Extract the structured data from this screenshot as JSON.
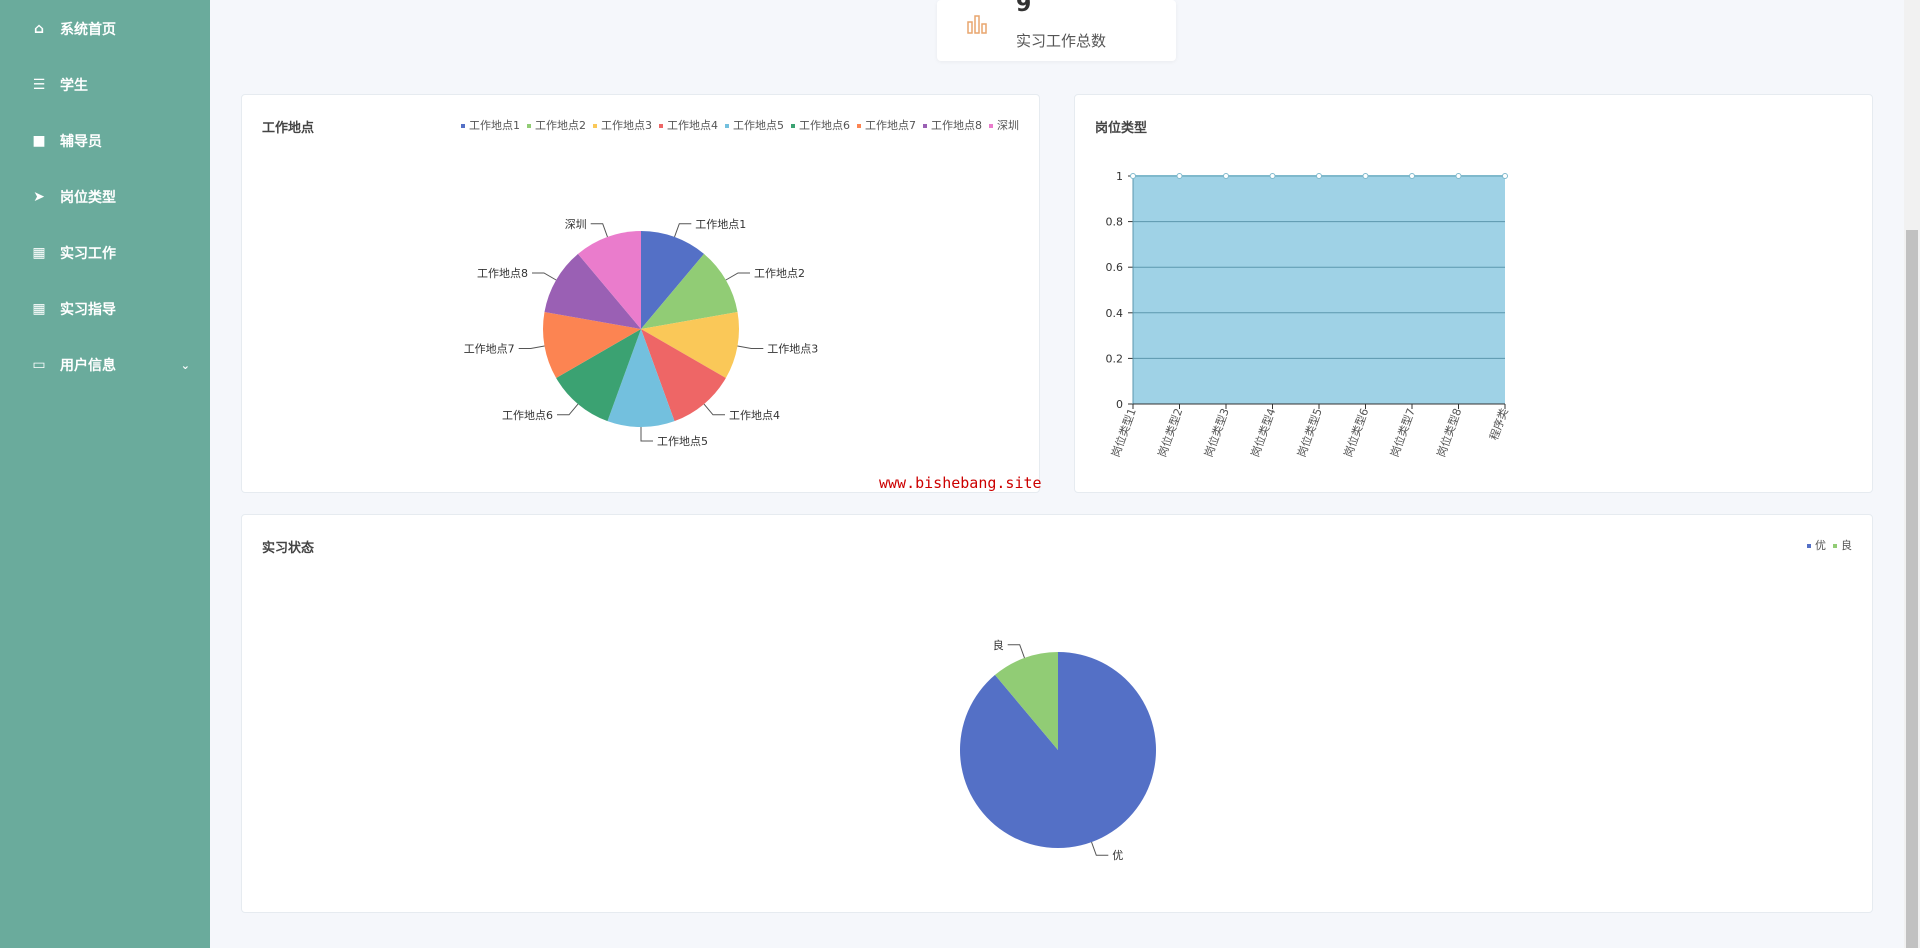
{
  "sidebar": {
    "items": [
      {
        "label": "系统首页",
        "icon": "home-icon",
        "glyph": "⌂"
      },
      {
        "label": "学生",
        "icon": "sliders-icon",
        "glyph": "☰"
      },
      {
        "label": "辅导员",
        "icon": "user-icon",
        "glyph": "■"
      },
      {
        "label": "岗位类型",
        "icon": "send-icon",
        "glyph": "➤"
      },
      {
        "label": "实习工作",
        "icon": "grid-icon",
        "glyph": "▦"
      },
      {
        "label": "实习指导",
        "icon": "grid-icon",
        "glyph": "▦"
      },
      {
        "label": "用户信息",
        "icon": "card-icon",
        "glyph": "▭",
        "expandable": true
      }
    ]
  },
  "stat": {
    "value": "9",
    "label": "实习工作总数",
    "icon": "bar-chart-icon"
  },
  "watermark": "www.bishebang.site",
  "chart_data": [
    {
      "type": "pie",
      "title": "工作地点",
      "legend_position": "top-right",
      "categories": [
        "工作地点1",
        "工作地点2",
        "工作地点3",
        "工作地点4",
        "工作地点5",
        "工作地点6",
        "工作地点7",
        "工作地点8",
        "深圳"
      ],
      "values": [
        1,
        1,
        1,
        1,
        1,
        1,
        1,
        1,
        1
      ],
      "colors": [
        "#5470c6",
        "#91cc75",
        "#fac858",
        "#ee6666",
        "#73c0de",
        "#3ba272",
        "#fc8452",
        "#9a60b4",
        "#ea7ccc"
      ]
    },
    {
      "type": "area",
      "title": "岗位类型",
      "categories": [
        "岗位类型1",
        "岗位类型2",
        "岗位类型3",
        "岗位类型4",
        "岗位类型5",
        "岗位类型6",
        "岗位类型7",
        "岗位类型8",
        "程序类"
      ],
      "values": [
        1,
        1,
        1,
        1,
        1,
        1,
        1,
        1,
        1
      ],
      "ylim": [
        0,
        1
      ],
      "yticks": [
        "0",
        "0.2",
        "0.4",
        "0.6",
        "0.8",
        "1"
      ],
      "grid": true,
      "color": "#9fd2e6"
    },
    {
      "type": "pie",
      "title": "实习状态",
      "legend_position": "top-right",
      "categories": [
        "优",
        "良"
      ],
      "values": [
        8,
        1
      ],
      "colors": [
        "#5470c6",
        "#91cc75"
      ]
    }
  ]
}
